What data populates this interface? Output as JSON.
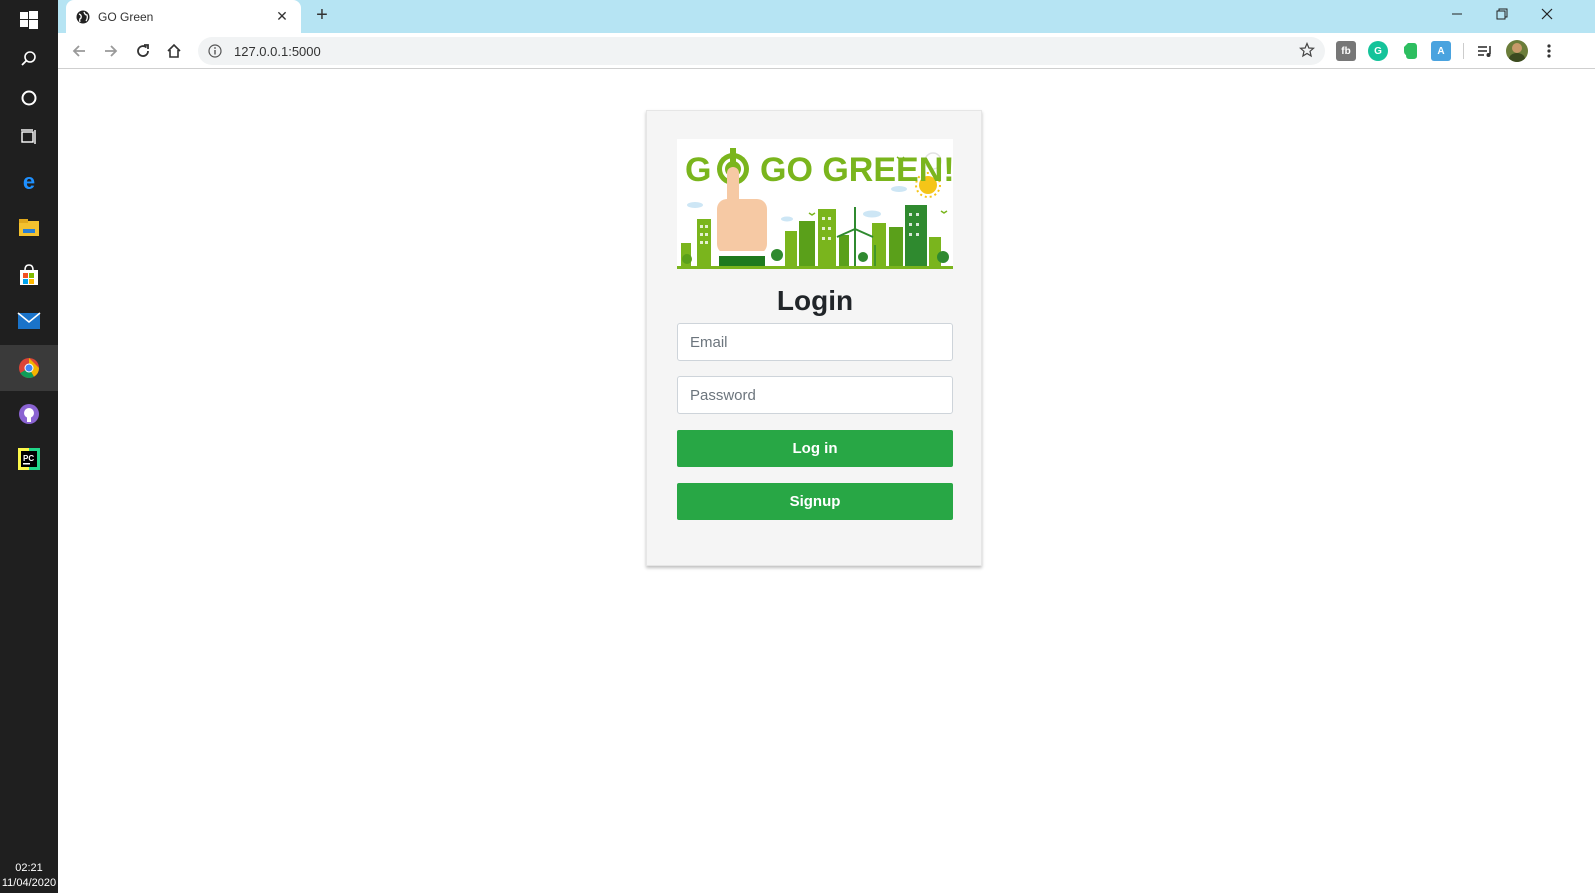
{
  "taskbar": {
    "icons": [
      "windows-start-icon",
      "search-icon",
      "cortana-icon",
      "task-view-icon",
      "edge-icon",
      "file-explorer-icon",
      "store-icon",
      "mail-icon",
      "chrome-icon",
      "github-icon",
      "pycharm-icon"
    ],
    "clock_time": "02:21",
    "clock_date": "11/04/2020"
  },
  "browser": {
    "tab_title": "GO Green",
    "url": "127.0.0.1:5000",
    "tab_color": "#b6e4f3"
  },
  "login": {
    "banner_text": "GO GREEN!",
    "title": "Login",
    "email_placeholder": "Email",
    "password_placeholder": "Password",
    "login_button": "Log in",
    "signup_button": "Signup",
    "accent_color": "#28a745"
  }
}
